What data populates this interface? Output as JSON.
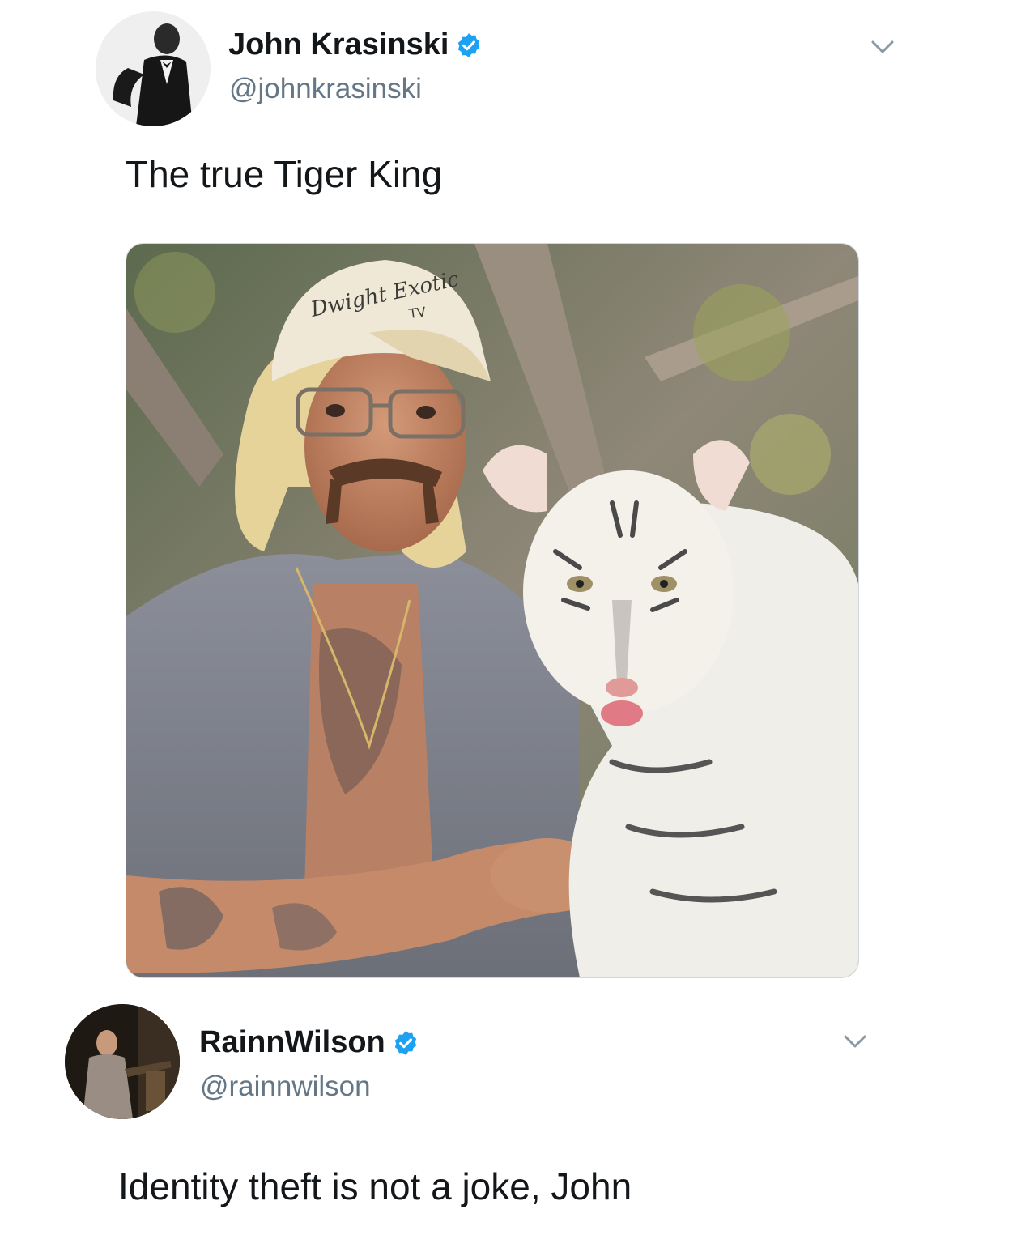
{
  "tweets": [
    {
      "display_name": "John Krasinski",
      "handle": "@johnkrasinski",
      "verified": true,
      "text": "The true Tiger King",
      "has_media": true
    },
    {
      "display_name": "RainnWilson",
      "handle": "@rainnwilson",
      "verified": true,
      "text": "Identity theft is not a joke, John",
      "has_media": false
    }
  ],
  "media": {
    "hat_text": "Dwight Exotic",
    "hat_subtext": "TV"
  },
  "colors": {
    "verified_blue": "#1da1f2",
    "handle_gray": "#657786",
    "text_dark": "#14171a"
  },
  "icons": {
    "verified": "verified-badge-icon",
    "more": "chevron-down-icon"
  }
}
